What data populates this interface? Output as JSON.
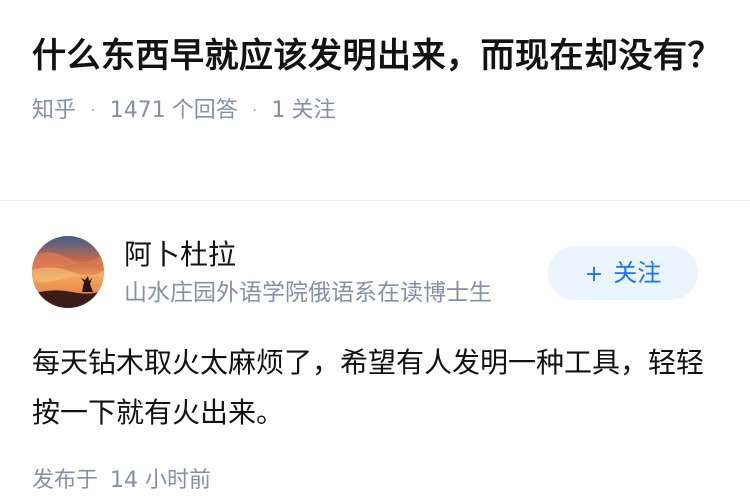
{
  "question": {
    "title": "什么东西早就应该发明出来，而现在却没有？",
    "source": "知乎",
    "answer_count": "1471",
    "answer_label": "个回答",
    "follower_count": "1",
    "follower_label": "关注"
  },
  "author": {
    "name": "阿卜杜拉",
    "bio": "山水庄园外语学院俄语系在读博士生",
    "follow_label": "关注",
    "follow_prefix": "+"
  },
  "answer": {
    "text": "每天钻木取火太麻烦了，希望有人发明一种工具，轻轻按一下就有火出来。"
  },
  "meta": {
    "publish_label": "发布于",
    "publish_time": "14 小时前"
  },
  "colors": {
    "primary_text": "#121212",
    "secondary_text": "#8590a6",
    "accent": "#1772f6",
    "follow_bg": "#ebf5ff"
  },
  "icons": {
    "avatar": "sunset-silhouette-avatar"
  }
}
